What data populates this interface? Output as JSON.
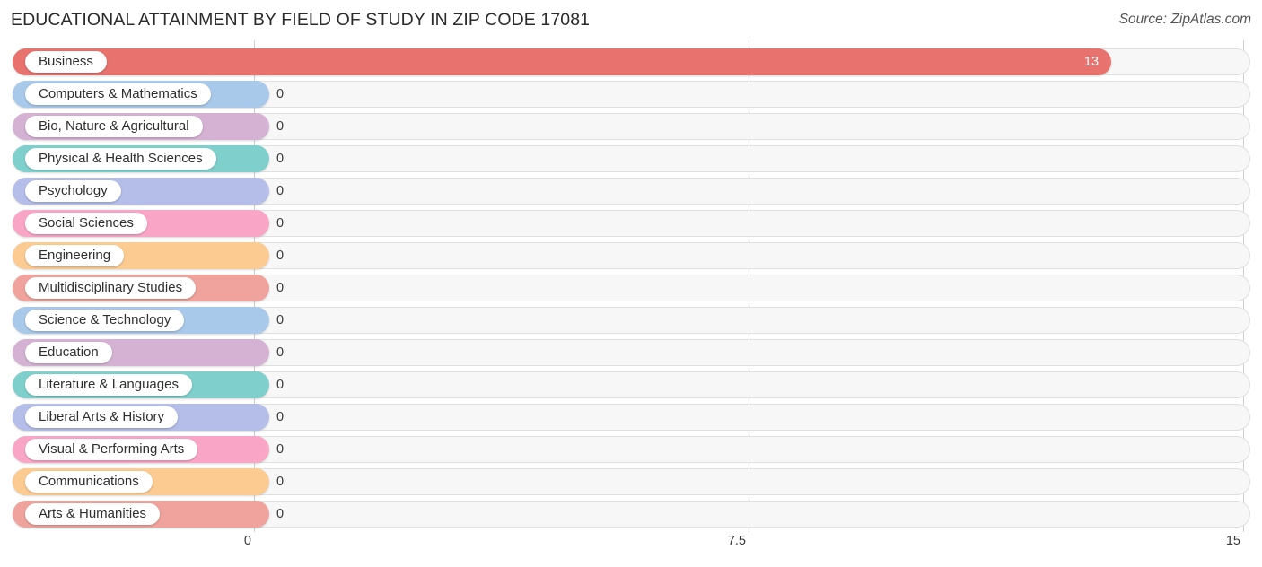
{
  "header": {
    "title": "EDUCATIONAL ATTAINMENT BY FIELD OF STUDY IN ZIP CODE 17081",
    "source": "Source: ZipAtlas.com"
  },
  "axis": {
    "ticks": [
      "0",
      "7.5",
      "15"
    ],
    "tick_values": [
      0,
      7.5,
      15
    ]
  },
  "chart_data": {
    "type": "bar",
    "orientation": "horizontal",
    "title": "EDUCATIONAL ATTAINMENT BY FIELD OF STUDY IN ZIP CODE 17081",
    "subtitle": "",
    "xlabel": "",
    "ylabel": "",
    "xlim": [
      0,
      15
    ],
    "grid": true,
    "legend": "none",
    "source": "Source: ZipAtlas.com",
    "categories": [
      "Business",
      "Computers & Mathematics",
      "Bio, Nature & Agricultural",
      "Physical & Health Sciences",
      "Psychology",
      "Social Sciences",
      "Engineering",
      "Multidisciplinary Studies",
      "Science & Technology",
      "Education",
      "Literature & Languages",
      "Liberal Arts & History",
      "Visual & Performing Arts",
      "Communications",
      "Arts & Humanities"
    ],
    "values": [
      13,
      0,
      0,
      0,
      0,
      0,
      0,
      0,
      0,
      0,
      0,
      0,
      0,
      0,
      0
    ],
    "value_labels": [
      "13",
      "0",
      "0",
      "0",
      "0",
      "0",
      "0",
      "0",
      "0",
      "0",
      "0",
      "0",
      "0",
      "0",
      "0"
    ],
    "colors": [
      "#e8726e",
      "#a9c9ea",
      "#d5b2d4",
      "#7fd0cd",
      "#b4bee8",
      "#f9a6c6",
      "#fbcb92",
      "#efa39c",
      "#a9c9ea",
      "#d5b2d4",
      "#7fd0cd",
      "#b4bee8",
      "#f9a6c6",
      "#fbcb92",
      "#efa39c"
    ]
  },
  "style": {
    "track_fill": "#f7f7f7",
    "track_border": "#e0e0e0",
    "gridline_color": "#cfcfcf",
    "title_color": "#2b2b2b",
    "source_color": "#555555",
    "pill_bg": "#ffffff"
  }
}
